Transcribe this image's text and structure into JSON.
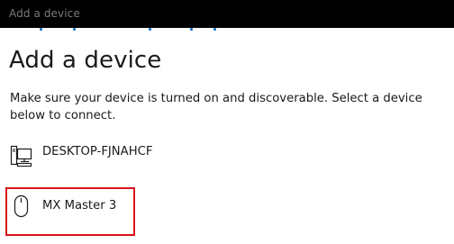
{
  "window": {
    "title": "Add a device"
  },
  "page": {
    "heading": "Add a device",
    "description": "Make sure your device is turned on and discoverable. Select a device below to connect."
  },
  "devices": [
    {
      "label": "DESKTOP-FJNAHCF",
      "icon": "desktop-computer-icon"
    },
    {
      "label": "MX Master 3",
      "icon": "mouse-icon",
      "highlighted": true
    }
  ],
  "colors": {
    "titlebar_bg": "#000000",
    "titlebar_text": "#7a7a7a",
    "accent": "#0067c0",
    "highlight": "#d9141a",
    "text": "#1a1a1a"
  }
}
